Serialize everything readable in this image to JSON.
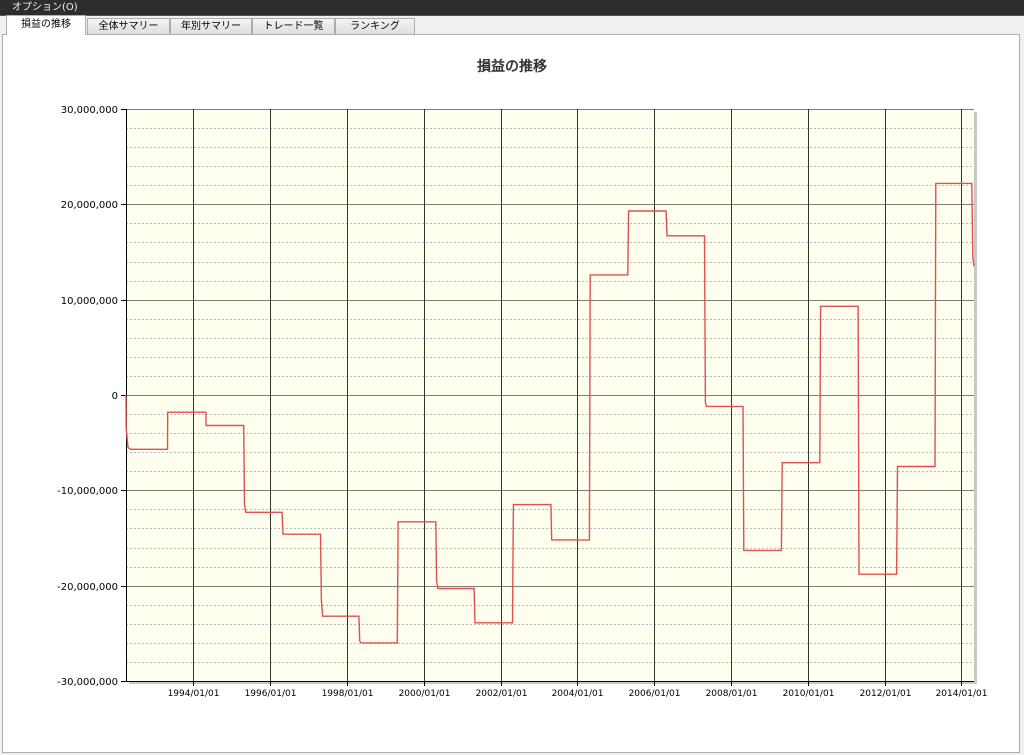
{
  "menu": {
    "options_label": "オプション(O)"
  },
  "tabs": [
    {
      "label": "損益の推移",
      "active": true
    },
    {
      "label": "全体サマリー",
      "active": false
    },
    {
      "label": "年別サマリー",
      "active": false
    },
    {
      "label": "トレード一覧",
      "active": false
    },
    {
      "label": "ランキング",
      "active": false
    }
  ],
  "colors": {
    "plot_bg": "#fffff0",
    "line": "#e05050",
    "grid_major": "#000000",
    "grid_minor": "#bbbbbb"
  },
  "chart_data": {
    "type": "line",
    "title": "損益の推移",
    "xlabel": "",
    "ylabel": "",
    "ylim": [
      -30000000,
      30000000
    ],
    "xlim": [
      "1992/04/01",
      "2014/05/01"
    ],
    "y_ticks": [
      30000000,
      20000000,
      10000000,
      0,
      -10000000,
      -20000000,
      -30000000
    ],
    "y_tick_labels": [
      "30,000,000",
      "20,000,000",
      "10,000,000",
      "0",
      "-10,000,000",
      "-20,000,000",
      "-30,000,000"
    ],
    "x_ticks": [
      "1994/01/01",
      "1996/01/01",
      "1998/01/01",
      "2000/01/01",
      "2002/01/01",
      "2004/01/01",
      "2006/01/01",
      "2008/01/01",
      "2010/01/01",
      "2012/01/01",
      "2014/01/01"
    ],
    "grid": true,
    "legend": "none",
    "series": [
      {
        "x": [
          "1992/04/01",
          "1992/04/03",
          "1992/04/20",
          "1992/05/15",
          "1993/05/01",
          "1993/05/03",
          "1994/05/01",
          "1994/05/03",
          "1995/04/25",
          "1995/05/03",
          "1995/05/15",
          "1996/04/25",
          "1996/05/03",
          "1997/04/25",
          "1997/05/03",
          "1997/05/15",
          "1998/04/25",
          "1998/05/03",
          "1998/05/15",
          "1999/04/25",
          "1999/05/03",
          "2000/04/25",
          "2000/05/03",
          "2000/05/15",
          "2001/04/25",
          "2001/05/03",
          "2002/04/25",
          "2002/05/03",
          "2003/04/25",
          "2003/05/03",
          "2004/04/25",
          "2004/05/03",
          "2005/04/25",
          "2005/05/03",
          "2006/04/25",
          "2006/05/03",
          "2007/04/25",
          "2007/05/03",
          "2007/05/15",
          "2008/04/25",
          "2008/05/03",
          "2009/04/25",
          "2009/05/03",
          "2010/04/25",
          "2010/05/03",
          "2011/04/25",
          "2011/05/03",
          "2012/04/25",
          "2012/05/03",
          "2013/04/25",
          "2013/05/03",
          "2014/04/10",
          "2014/04/20",
          "2014/05/01"
        ],
        "y": [
          0,
          -3500000,
          -5500000,
          -5700000,
          -5700000,
          -1800000,
          -1800000,
          -3200000,
          -3200000,
          -11500000,
          -12300000,
          -12300000,
          -14600000,
          -14600000,
          -21500000,
          -23200000,
          -23200000,
          -25800000,
          -26000000,
          -26000000,
          -13300000,
          -13300000,
          -19500000,
          -20300000,
          -20300000,
          -23900000,
          -23900000,
          -11500000,
          -11500000,
          -15200000,
          -15200000,
          12600000,
          12600000,
          19300000,
          19300000,
          16700000,
          16700000,
          -800000,
          -1200000,
          -1200000,
          -16300000,
          -16300000,
          -7100000,
          -7100000,
          9300000,
          9300000,
          -18800000,
          -18800000,
          -7500000,
          -7500000,
          22200000,
          22200000,
          14500000,
          13500000
        ]
      }
    ]
  }
}
